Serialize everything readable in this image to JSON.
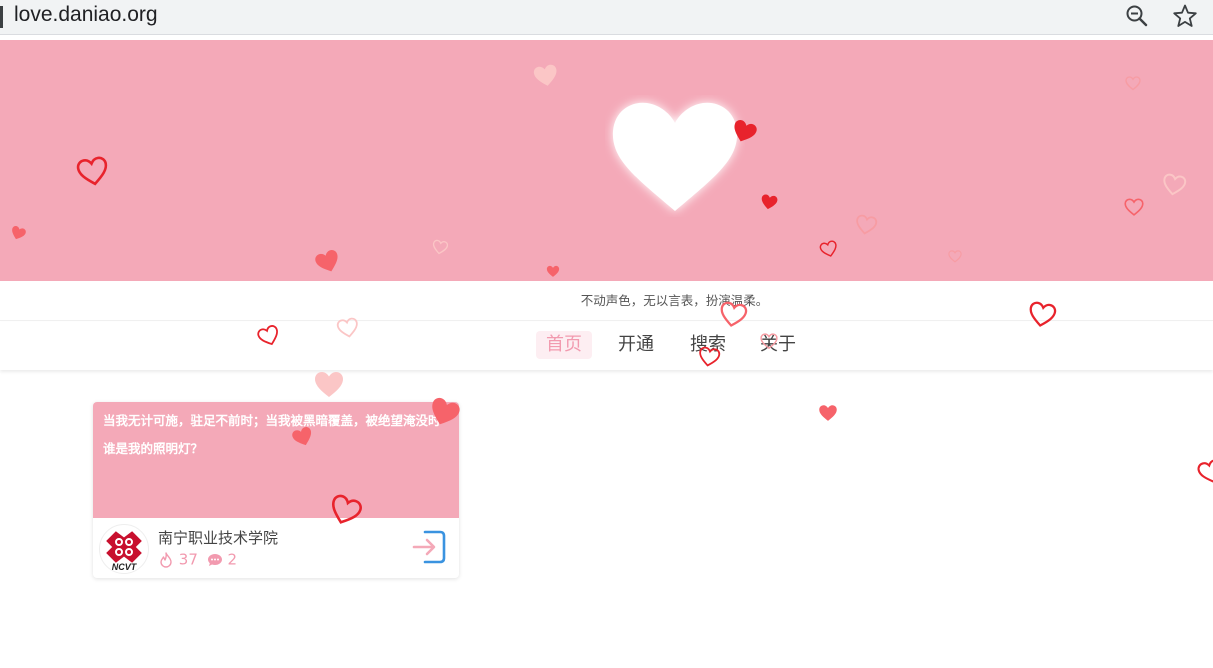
{
  "browser": {
    "url": "love.daniao.org",
    "zoom_icon": "zoom-out-icon",
    "star_icon": "bookmark-star-icon"
  },
  "banner": {
    "color": "#f4a9b8",
    "heart_icon": "big-white-heart-icon"
  },
  "motto": "不动声色，无以言表，扮演温柔。",
  "nav": {
    "items": [
      {
        "label": "首页",
        "active": true
      },
      {
        "label": "开通",
        "active": false
      },
      {
        "label": "搜索",
        "active": false
      },
      {
        "label": "关于",
        "active": false
      }
    ],
    "active_bg": "#fdeef2",
    "active_color": "#f29aaf"
  },
  "card": {
    "text": "当我无计可施，驻足不前时；当我被黑暗覆盖，被绝望淹没时 谁是我的照明灯？",
    "school": "南宁职业技术学院",
    "logo_text": "NCVT",
    "likes": "37",
    "comments": "2",
    "like_icon": "flame-icon",
    "comment_icon": "chat-bubble-icon",
    "enter_icon": "enter-arrow-icon"
  },
  "decor": {
    "heart_colors": [
      "#e8232c",
      "#f6636a",
      "#f79ca3",
      "#fbc6c6"
    ]
  }
}
